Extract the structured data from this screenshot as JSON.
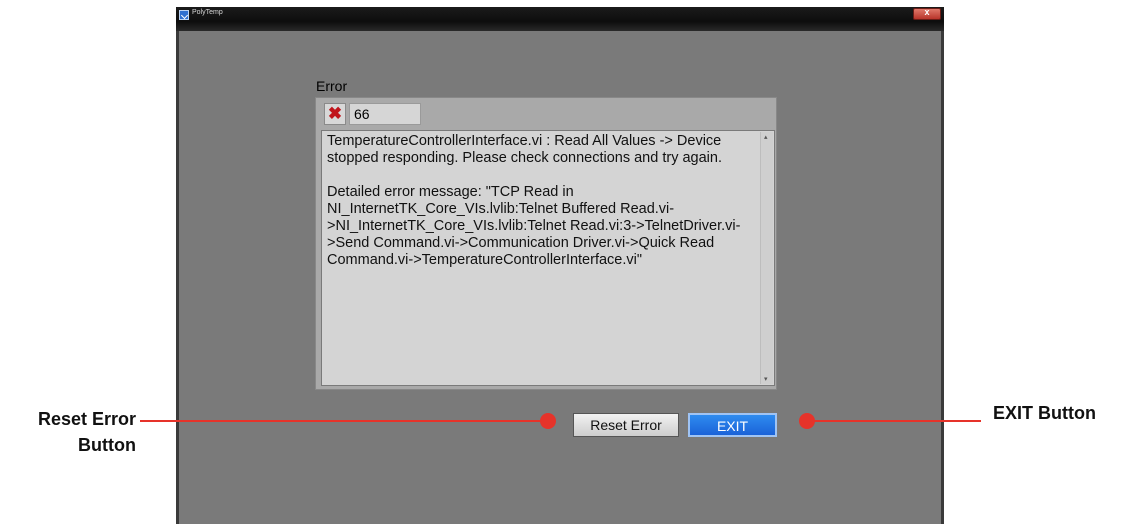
{
  "window": {
    "title": "PolyTemp",
    "close_glyph": "x"
  },
  "error_cluster": {
    "label": "Error",
    "status_icon": "error-x-icon",
    "status_color": "#c0141b",
    "code": "66",
    "source": "TemperatureControllerInterface.vi : Read All Values -> Device stopped responding.  Please check connections and try again.\n\nDetailed error message:  \"TCP Read in NI_InternetTK_Core_VIs.lvlib:Telnet Buffered Read.vi->NI_InternetTK_Core_VIs.lvlib:Telnet Read.vi:3->TelnetDriver.vi->Send Command.vi->Communication Driver.vi->Quick Read Command.vi->TemperatureControllerInterface.vi\""
  },
  "buttons": {
    "reset_label": "Reset Error",
    "exit_label": "EXIT"
  },
  "annotations": {
    "reset_line1": "Reset Error",
    "reset_line2": "Button",
    "exit": "EXIT Button",
    "marker_color": "#e6332a"
  }
}
